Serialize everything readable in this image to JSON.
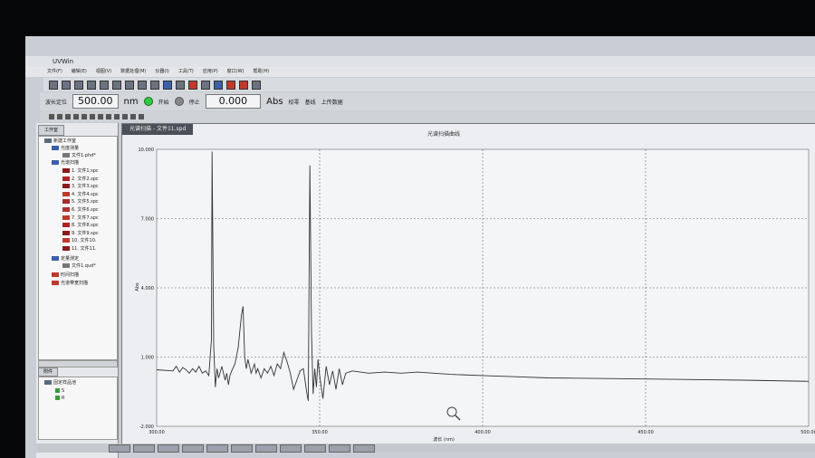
{
  "app": {
    "title": "UVWin"
  },
  "menu": [
    "文件(F)",
    "编辑(E)",
    "视图(V)",
    "数据处理(M)",
    "仪器(I)",
    "工具(T)",
    "应用(P)",
    "窗口(W)",
    "帮助(H)"
  ],
  "controls": {
    "wavelength_label": "波长定位",
    "wavelength_value": "500.00",
    "wavelength_unit": "nm",
    "status1": "开始",
    "status2": "停止",
    "abs_value": "0.000",
    "abs_unit": "Abs",
    "zero_label": "校零",
    "baseline_label": "基线",
    "upload_label": "上传数据"
  },
  "workspace": {
    "tab": "工作室",
    "root": "新建工作室",
    "photometric": "光度测量",
    "photometric_file": "文件1.phd*",
    "spectrum": "光谱扫描",
    "spectrum_files": [
      "1. 文件1.spc",
      "2. 文件2.spc",
      "3. 文件3.spc",
      "4. 文件4.spc",
      "5. 文件5.spc",
      "6. 文件6.spc",
      "7. 文件7.spc",
      "8. 文件8.spc",
      "9. 文件9.spc",
      "10. 文件10.",
      "11. 文件11."
    ],
    "quant": "定量测定",
    "quant_file": "文件1.qud*",
    "timescan": "时间扫描",
    "dna": "光谱带宽扫描"
  },
  "samples": {
    "tab": "附件",
    "root": "固定样品池",
    "items": [
      "S",
      "R"
    ]
  },
  "colors": {
    "file_icons": [
      "#8b1a1a",
      "#b22222",
      "#8b1a1a",
      "#c0392b",
      "#a52a2a",
      "#b03030",
      "#c0392b",
      "#b22222",
      "#8b1a1a",
      "#c0392b",
      "#8b1a1a"
    ]
  },
  "chart_tab": "光谱扫描 - 文件11.spd",
  "chart_data": {
    "type": "line",
    "title": "光谱扫描曲线",
    "xlabel": "波长 (nm)",
    "ylabel": "Abs",
    "xlim": [
      300,
      500
    ],
    "ylim": [
      -2,
      10
    ],
    "xticks": [
      "300.00",
      "350.00",
      "400.00",
      "450.00",
      "500.00"
    ],
    "yticks": [
      "10.000",
      "7.000",
      "4.000",
      "1.000",
      "-2.000"
    ],
    "x": [
      300,
      305,
      306,
      307,
      308,
      309,
      310,
      311,
      312,
      313,
      314,
      315,
      316,
      316.8,
      317,
      317.5,
      318,
      318.5,
      319,
      320,
      321,
      321.5,
      322,
      322.5,
      323,
      324,
      325,
      326,
      326.5,
      327,
      327.5,
      328,
      329,
      330,
      330.5,
      331,
      332,
      333,
      334,
      335,
      336,
      337,
      338,
      339,
      340,
      341,
      342,
      343,
      344,
      345,
      346,
      346.5,
      347,
      347.5,
      348,
      348.5,
      349,
      349.5,
      350,
      351,
      352,
      353,
      354,
      355,
      356,
      357,
      358,
      360,
      365,
      370,
      375,
      380,
      385,
      390,
      400,
      410,
      420,
      450,
      480,
      500
    ],
    "values": [
      0.45,
      0.4,
      0.6,
      0.35,
      0.55,
      0.45,
      0.3,
      0.5,
      0.35,
      0.6,
      0.3,
      0.4,
      0.2,
      1.8,
      9.9,
      1.5,
      -0.3,
      0.5,
      0.1,
      0.6,
      0.0,
      0.3,
      -0.2,
      0.2,
      0.4,
      0.7,
      1.4,
      2.8,
      3.2,
      1.0,
      0.5,
      0.9,
      0.3,
      0.7,
      0.3,
      0.5,
      0.1,
      0.5,
      0.3,
      0.6,
      0.2,
      0.7,
      0.5,
      1.2,
      0.8,
      0.3,
      -0.4,
      0.0,
      0.4,
      0.5,
      -0.5,
      -0.9,
      9.3,
      2.0,
      -0.6,
      0.5,
      -0.3,
      0.9,
      0.2,
      -0.8,
      0.6,
      -0.2,
      0.4,
      -0.4,
      0.5,
      -0.2,
      0.3,
      0.4,
      0.3,
      0.35,
      0.3,
      0.35,
      0.3,
      0.25,
      0.2,
      0.15,
      0.1,
      0.05,
      0.0,
      -0.05
    ]
  }
}
